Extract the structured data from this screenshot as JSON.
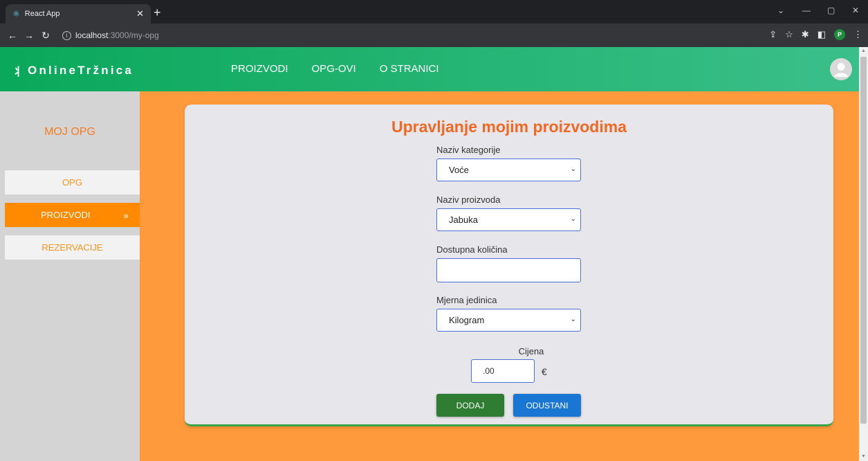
{
  "browser": {
    "tab_title": "React App",
    "tab_favicon": "react-icon",
    "url_host": "localhost",
    "url_path": ":3000/my-opg",
    "profile_initial": "P"
  },
  "header": {
    "logo_text": "OnlineTržnica",
    "logo_icon": "leaf-icon",
    "nav": [
      "PROIZVODI",
      "OPG-OVI",
      "O STRANICI"
    ],
    "avatar_icon": "user-avatar-icon"
  },
  "sidebar": {
    "title": "MOJ OPG",
    "items": [
      {
        "label": "OPG",
        "active": false
      },
      {
        "label": "PROIZVODI",
        "active": true
      },
      {
        "label": "REZERVACIJE",
        "active": false
      }
    ]
  },
  "form": {
    "title": "Upravljanje mojim proizvodima",
    "category_label": "Naziv kategorije",
    "category_value": "Voće",
    "product_label": "Naziv proizvoda",
    "product_value": "Jabuka",
    "quantity_label": "Dostupna količina",
    "quantity_value": "",
    "unit_label": "Mjerna jedinica",
    "unit_value": "Kilogram",
    "price_label": "Cijena",
    "price_value": ".00",
    "currency": "€",
    "add_label": "DODAJ",
    "cancel_label": "ODUSTANI"
  },
  "colors": {
    "header_start": "#0aa85a",
    "page_bg": "#ff9a3c",
    "accent_orange": "#f26722",
    "add_button": "#2e7d32",
    "cancel_button": "#1976d2"
  }
}
